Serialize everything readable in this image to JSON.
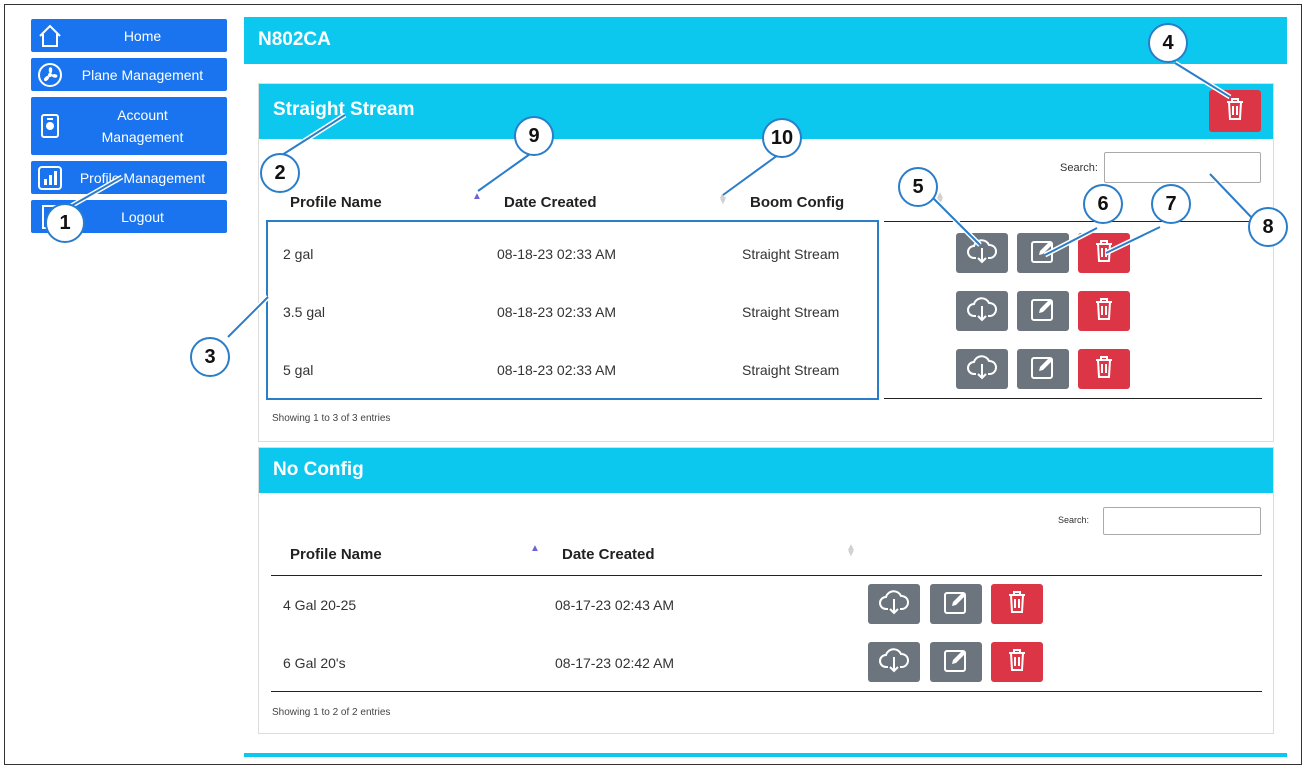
{
  "sidebar": {
    "items": [
      {
        "label": "Home",
        "icon": "home-icon"
      },
      {
        "label": "Plane Management",
        "icon": "fan-icon"
      },
      {
        "label": "Account\nManagement",
        "icon": "account-icon"
      },
      {
        "label": "Profile Management",
        "icon": "chart-icon"
      },
      {
        "label": "Logout",
        "icon": "door-icon"
      }
    ]
  },
  "header": {
    "title": "N802CA"
  },
  "panel1": {
    "title": "Straight Stream",
    "search_label": "Search:",
    "columns": [
      "Profile Name",
      "Date Created",
      "Boom Config"
    ],
    "rows": [
      {
        "name": "2 gal",
        "date": "08-18-23 02:33 AM",
        "config": "Straight Stream"
      },
      {
        "name": "3.5 gal",
        "date": "08-18-23 02:33 AM",
        "config": "Straight Stream"
      },
      {
        "name": "5 gal",
        "date": "08-18-23 02:33 AM",
        "config": "Straight Stream"
      }
    ],
    "info": "Showing 1 to 3 of 3 entries"
  },
  "panel2": {
    "title": "No Config",
    "search_label": "Search:",
    "columns": [
      "Profile Name",
      "Date Created"
    ],
    "rows": [
      {
        "name": "4 Gal 20-25",
        "date": "08-17-23 02:43 AM"
      },
      {
        "name": "6 Gal 20's",
        "date": "08-17-23 02:42 AM"
      }
    ],
    "info": "Showing 1 to 2 of 2 entries"
  },
  "callouts": [
    "1",
    "2",
    "3",
    "4",
    "5",
    "6",
    "7",
    "8",
    "9",
    "10"
  ],
  "colors": {
    "primary": "#1a74f0",
    "header": "#0dc8ee",
    "danger": "#dc3545",
    "secondary": "#6c757d",
    "callout": "#2a7dc9"
  }
}
